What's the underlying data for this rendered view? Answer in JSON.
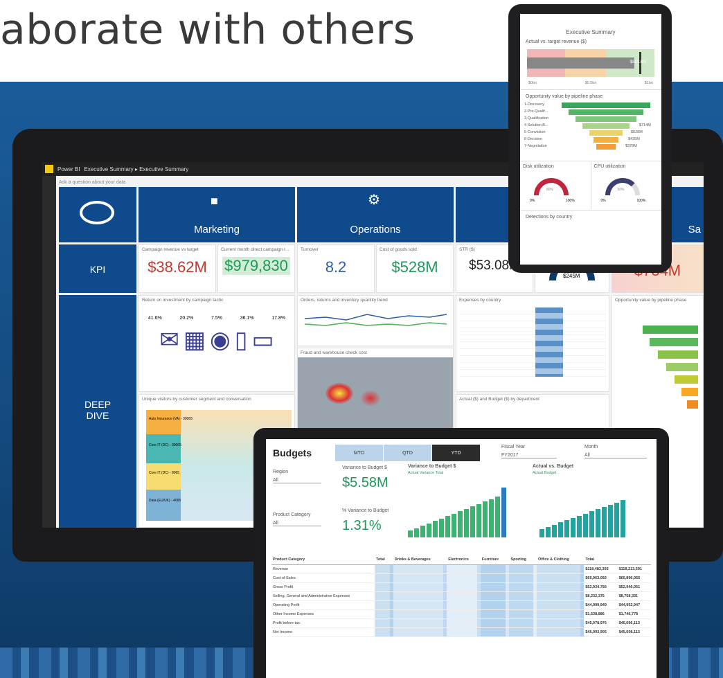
{
  "headline": "aborate with others",
  "laptop": {
    "app_name": "Power BI",
    "breadcrumb": "Executive Summary ▸ Executive Summary",
    "qa_placeholder": "Ask a question about your data",
    "tiles": {
      "marketing": "Marketing",
      "operations": "Operations",
      "sales": "Sa",
      "kpi": "KPI",
      "deep_dive": "DEEP DIVE",
      "campaign_title": "Campaign revenue vs target",
      "campaign_value": "$38.62M",
      "current_title": "Current month direct campaign r...",
      "current_value": "$979,830",
      "turnover_title": "Turnover",
      "turnover_value": "8.2",
      "cogs_title": "Cost of goods sold",
      "cogs_value": "$528M",
      "str_title": "STR ($)",
      "str_value": "$53.08M",
      "gauge_value": "$245M",
      "sales_value": "$784M",
      "roi_title": "Return on investment by campaign tactic",
      "roi_pcts": [
        "41.6%",
        "20.2%",
        "7.5%",
        "36.1%",
        "17.8%"
      ],
      "orders_title": "Orders, returns and inventory quantity trend",
      "fraud_title": "Fraud and warehouse check cost",
      "expenses_title": "Expenses by country",
      "budget_title": "Actual ($) and Budget ($) by department",
      "opp_title": "Opportunity value by pipeline phase",
      "visitors_title": "Unique visitors by customer segment and conversation",
      "flows": [
        "Auto Insurance (VA) - 30065",
        "Core IT (DC) - 30065",
        "Core IT (DC) - 8065",
        "Data (EU/UK) - 4065"
      ]
    }
  },
  "phone": {
    "title": "Executive Summary",
    "sec1": "Actual vs. target revenue ($)",
    "bullet_value": "$821.8M",
    "axis": [
      "$0bn",
      "$0.5bn",
      "$1bn"
    ],
    "sec2": "Opportunity value by pipeline phase",
    "phases": [
      "1-Discovery",
      "2-Pre-Qualif...",
      "3-Qualification",
      "4-Solution B...",
      "5-Conviction",
      "6-Decision",
      "7-Negotiation"
    ],
    "phase_vals": [
      "",
      "",
      "",
      "$714M",
      "$528M",
      "$435M",
      "$378M"
    ],
    "disk": "Disk utilization",
    "disk_pct": "80%",
    "cpu": "CPU utilization",
    "cpu_pct": "50%",
    "g_min": "0%",
    "g_max": "100%",
    "sec3": "Detections by country"
  },
  "tablet": {
    "title": "Budgets",
    "tabs": [
      "MTD",
      "QTD",
      "YTD"
    ],
    "region_label": "Region",
    "region_val": "All",
    "product_label": "Product Category",
    "product_val": "All",
    "fiscal_label": "Fiscal Year",
    "fiscal_val": "FY2017",
    "month_label": "Month",
    "month_val": "All",
    "var_label": "Variance to Budget $",
    "var_value": "$5.58M",
    "pct_label": "% Variance to Budget",
    "pct_value": "1.31%",
    "chart1_title": "Variance to Budget $",
    "legend1": [
      "Actual",
      "Variance",
      "Total"
    ],
    "chart2_title": "Actual vs. Budget",
    "legend2": [
      "Actual",
      "Budget"
    ],
    "table_header": [
      "Product Category",
      "Total",
      "",
      "Drinks & Beverages",
      "",
      "Electronics",
      "",
      "Furniture",
      "",
      "Sporting",
      "",
      "Office & Clothing",
      "",
      "Total",
      ""
    ],
    "table_rows": [
      [
        "Revenue",
        "",
        "",
        "",
        "",
        "",
        "",
        "",
        "",
        "",
        "",
        "",
        "",
        "$118,483,393",
        "$118,213,591"
      ],
      [
        "Cost of Sales",
        "",
        "",
        "",
        "",
        "",
        "",
        "",
        "",
        "",
        "",
        "",
        "",
        "$65,963,092",
        "$65,896,055"
      ],
      [
        "Gross Profit",
        "",
        "",
        "",
        "",
        "",
        "",
        "",
        "",
        "",
        "",
        "",
        "",
        "$52,934,756",
        "$52,946,051"
      ],
      [
        "Selling, General and Administrative Expenses",
        "",
        "",
        "",
        "",
        "",
        "",
        "",
        "",
        "",
        "",
        "",
        "",
        "$8,232,375",
        "$8,758,331"
      ],
      [
        "Operating Profit",
        "",
        "",
        "",
        "",
        "",
        "",
        "",
        "",
        "",
        "",
        "",
        "",
        "$44,999,949",
        "$44,952,947"
      ],
      [
        "Other Income Expenses",
        "",
        "",
        "",
        "",
        "",
        "",
        "",
        "",
        "",
        "",
        "",
        "",
        "$1,538,886",
        "$1,746,778"
      ],
      [
        "Profit before tax",
        "",
        "",
        "",
        "",
        "",
        "",
        "",
        "",
        "",
        "",
        "",
        "",
        "$45,978,976",
        "$45,696,113"
      ],
      [
        "Net Income",
        "",
        "",
        "",
        "",
        "",
        "",
        "",
        "",
        "",
        "",
        "",
        "",
        "$45,093,905",
        "$45,608,113"
      ]
    ]
  }
}
